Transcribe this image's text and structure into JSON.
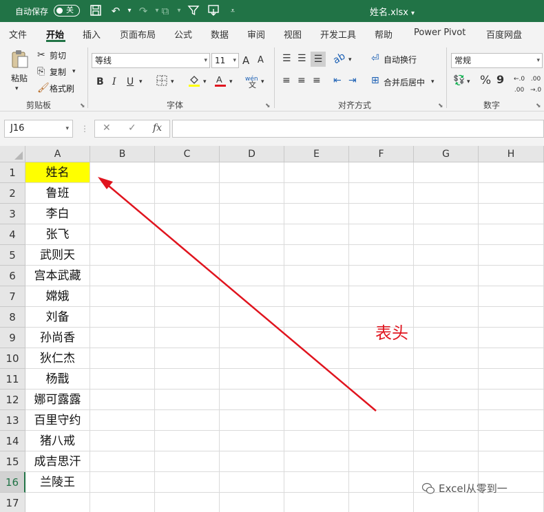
{
  "titlebar": {
    "autosave_label": "自动保存",
    "toggle_text": "关",
    "filename": "姓名.xlsx",
    "dropdown_glyph": "▾"
  },
  "menu": {
    "tabs": [
      "文件",
      "开始",
      "插入",
      "页面布局",
      "公式",
      "数据",
      "审阅",
      "视图",
      "开发工具",
      "帮助",
      "Power Pivot",
      "百度网盘"
    ],
    "active": "开始"
  },
  "ribbon": {
    "clipboard": {
      "paste": "粘贴",
      "cut": "剪切",
      "copy": "复制",
      "format_painter": "格式刷",
      "group_label": "剪贴板"
    },
    "font": {
      "font_name": "等线",
      "font_size": "11",
      "grow": "A",
      "shrink": "A",
      "bold": "B",
      "italic": "I",
      "underline": "U",
      "phonetic": "wén",
      "group_label": "字体"
    },
    "alignment": {
      "wrap_text": "自动换行",
      "merge_center": "合并后居中",
      "group_label": "对齐方式"
    },
    "number": {
      "format": "常规",
      "percent": "%",
      "comma": "9",
      "group_label": "数字"
    }
  },
  "formula_bar": {
    "name_box": "J16",
    "cancel": "✕",
    "enter": "✓",
    "fx": "fx",
    "content": ""
  },
  "sheet": {
    "columns": [
      "A",
      "B",
      "C",
      "D",
      "E",
      "F",
      "G",
      "H"
    ],
    "rows": [
      "1",
      "2",
      "3",
      "4",
      "5",
      "6",
      "7",
      "8",
      "9",
      "10",
      "11",
      "12",
      "13",
      "14",
      "15",
      "16",
      "17"
    ],
    "selected_row": "16",
    "column_a": [
      "姓名",
      "鲁班",
      "李白",
      "张飞",
      "武则天",
      "宫本武藏",
      "嫦娥",
      "刘备",
      "孙尚香",
      "狄仁杰",
      "杨戬",
      "娜可露露",
      "百里守约",
      "猪八戒",
      "成吉思汗",
      "兰陵王",
      ""
    ],
    "header_fill": "#ffff00"
  },
  "annotation": {
    "text": "表头",
    "color": "#e0141e"
  },
  "watermark": {
    "text": "Excel从零到一"
  },
  "colors": {
    "brand": "#217346"
  }
}
